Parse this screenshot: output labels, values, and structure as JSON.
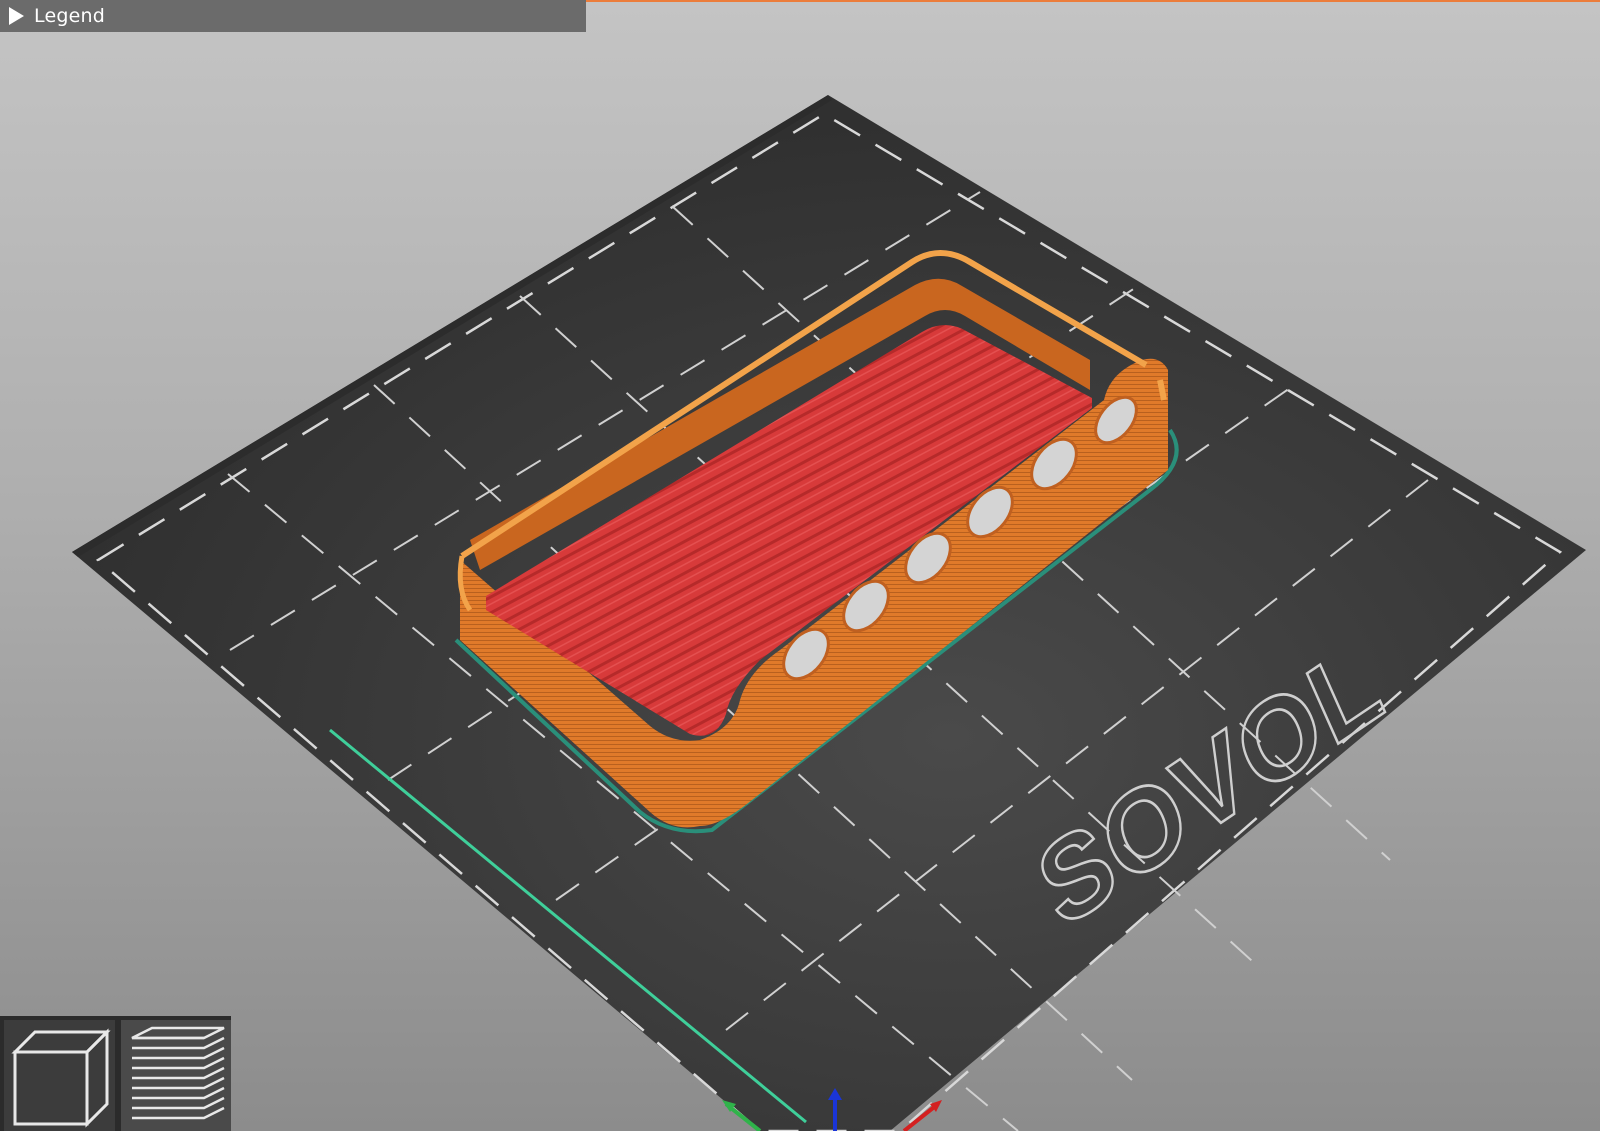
{
  "legend": {
    "label": "Legend"
  },
  "bed": {
    "brand_text": "SOVOL"
  },
  "toolbar": {
    "views": [
      {
        "icon": "3d-cube-icon",
        "active": false
      },
      {
        "icon": "layers-icon",
        "active": true
      }
    ]
  },
  "colors": {
    "accent": "#ec7d3b",
    "bed": "#383838",
    "perimeter": "#e07a2a",
    "solid_infill": "#d23a3a",
    "skirt": "#2a8f7a",
    "axis_x": "#d42020",
    "axis_y": "#2fb34a",
    "axis_z": "#1a35d8"
  }
}
